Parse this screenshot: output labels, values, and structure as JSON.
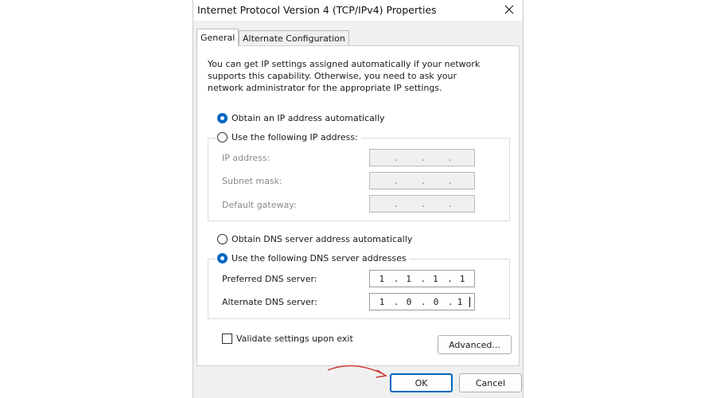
{
  "window": {
    "title": "Internet Protocol Version 4 (TCP/IPv4) Properties",
    "close_glyph": "✕"
  },
  "tabs": [
    {
      "label": "General",
      "active": true
    },
    {
      "label": "Alternate Configuration",
      "active": false
    }
  ],
  "intro_text": "You can get IP settings assigned automatically if your network supports this capability. Otherwise, you need to ask your network administrator for the appropriate IP settings.",
  "ip_section": {
    "auto_option": {
      "label": "Obtain an IP address automatically",
      "selected": true
    },
    "manual_option": {
      "label": "Use the following IP address:",
      "selected": false
    },
    "fields": [
      {
        "label": "IP address:",
        "value": [
          "",
          "",
          "",
          ""
        ],
        "enabled": false
      },
      {
        "label": "Subnet mask:",
        "value": [
          "",
          "",
          "",
          ""
        ],
        "enabled": false
      },
      {
        "label": "Default gateway:",
        "value": [
          "",
          "",
          "",
          ""
        ],
        "enabled": false
      }
    ]
  },
  "dns_section": {
    "auto_option": {
      "label": "Obtain DNS server address automatically",
      "selected": false
    },
    "manual_option": {
      "label": "Use the following DNS server addresses",
      "selected": true
    },
    "fields": [
      {
        "label": "Preferred DNS server:",
        "value": [
          "1",
          "1",
          "1",
          "1"
        ],
        "enabled": true
      },
      {
        "label": "Alternate DNS server:",
        "value": [
          "1",
          "0",
          "0",
          "1"
        ],
        "enabled": true
      }
    ]
  },
  "validate_checkbox": {
    "label": "Validate settings upon exit",
    "checked": false
  },
  "buttons": {
    "advanced": "Advanced...",
    "ok": "OK",
    "cancel": "Cancel"
  },
  "colors": {
    "accent": "#0067c0",
    "annotation_arrow": "#d0312d"
  },
  "icons": {
    "close": "close-icon",
    "arrow": "annotation-arrow-icon"
  }
}
